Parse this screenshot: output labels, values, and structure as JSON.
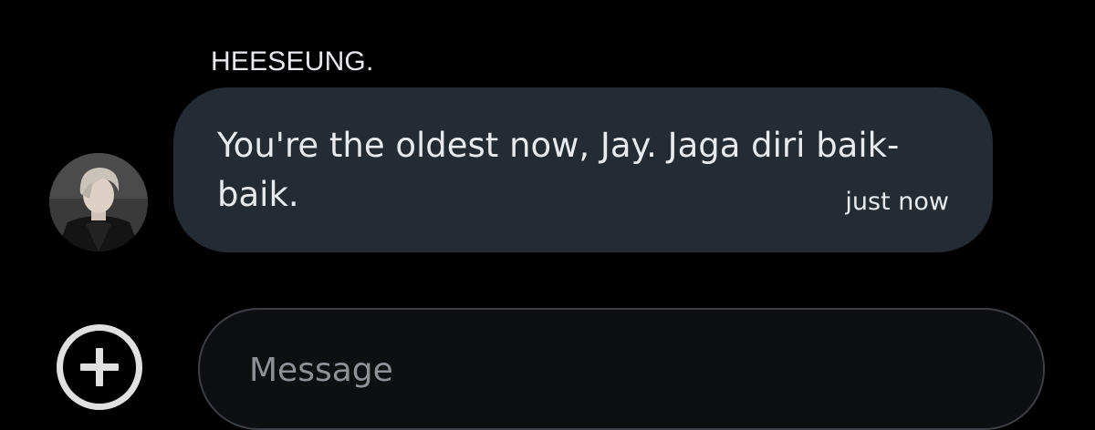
{
  "conversation": {
    "sender_name": "HEESEUNG.",
    "message": {
      "text": "You're the oldest now, Jay. Jaga diri baik-baik.",
      "timestamp": "just now"
    }
  },
  "composer": {
    "value": "",
    "placeholder": "Message",
    "add_icon": "plus-circle-icon"
  },
  "colors": {
    "background": "#000000",
    "bubble": "#242b33",
    "text": "#e8eaed",
    "placeholder": "#8e9196",
    "composer_border": "#3c3f44"
  }
}
